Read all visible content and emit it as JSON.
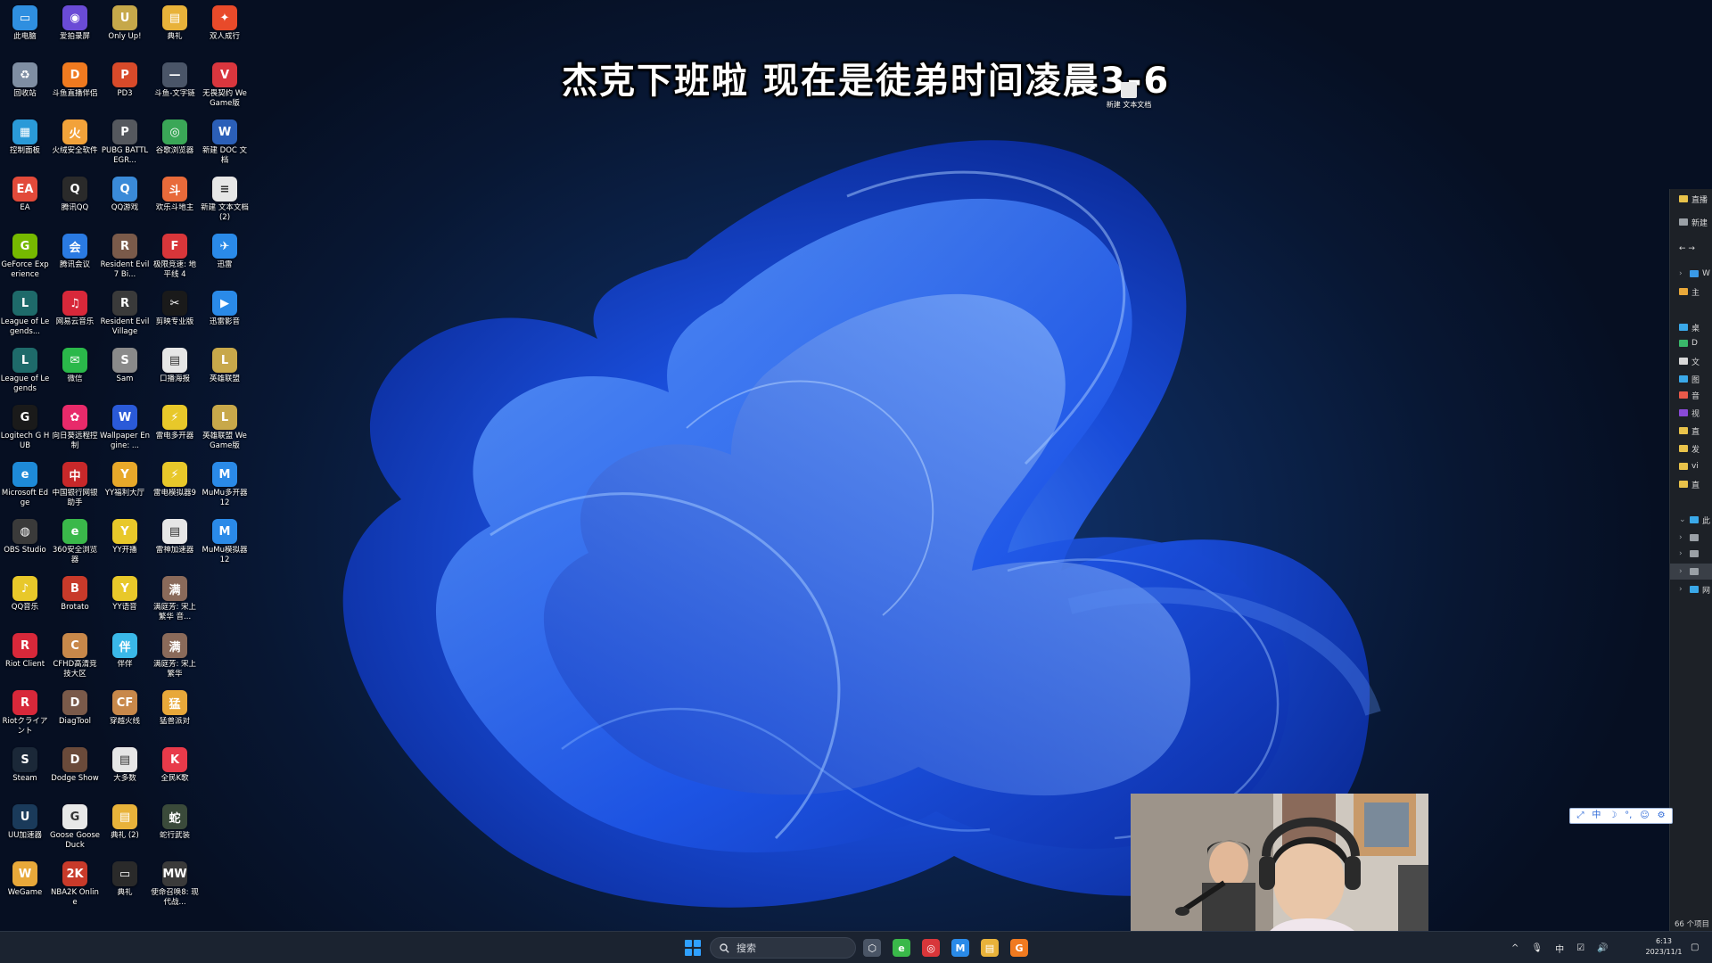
{
  "overlay_caption": "杰克下班啦 现在是徒弟时间凌晨3-6",
  "stray_file_label": "新建 文本文档",
  "desktop_icons": [
    {
      "label": "此电脑",
      "color": "#2f8fe0",
      "glyph": "▭"
    },
    {
      "label": "爱拍录屏",
      "color": "#6a4bd6",
      "glyph": "◉"
    },
    {
      "label": "Only Up!",
      "color": "#c6a84a",
      "glyph": "U"
    },
    {
      "label": "典礼",
      "color": "#e8b23a",
      "glyph": "▤"
    },
    {
      "label": "双人成行",
      "color": "#e84a2a",
      "glyph": "✦"
    },
    {
      "label": "回收站",
      "color": "#7f8ea3",
      "glyph": "♻"
    },
    {
      "label": "斗鱼直播伴侣",
      "color": "#f07a20",
      "glyph": "D"
    },
    {
      "label": "PD3",
      "color": "#d84a2a",
      "glyph": "P"
    },
    {
      "label": "斗鱼-文字链",
      "color": "#4a5568",
      "glyph": "—"
    },
    {
      "label": "无畏契约 WeGame版",
      "color": "#d9363e",
      "glyph": "V"
    },
    {
      "label": "控制面板",
      "color": "#2a9ad8",
      "glyph": "▦"
    },
    {
      "label": "火绒安全软件",
      "color": "#f2a23a",
      "glyph": "火"
    },
    {
      "label": "PUBG BATTLEGR...",
      "color": "#55585e",
      "glyph": "P"
    },
    {
      "label": "谷歌浏览器",
      "color": "#3aa757",
      "glyph": "◎"
    },
    {
      "label": "新建 DOC 文档",
      "color": "#2b5fb8",
      "glyph": "W"
    },
    {
      "label": "EA",
      "color": "#e24a3a",
      "glyph": "EA"
    },
    {
      "label": "腾讯QQ",
      "color": "#2a2a2a",
      "glyph": "Q"
    },
    {
      "label": "QQ游戏",
      "color": "#3a8ad8",
      "glyph": "Q"
    },
    {
      "label": "欢乐斗地主",
      "color": "#e86a3a",
      "glyph": "斗"
    },
    {
      "label": "新建 文本文档 (2)",
      "color": "#e6e6e6",
      "glyph": "≡"
    },
    {
      "label": "GeForce Experience",
      "color": "#76b900",
      "glyph": "G"
    },
    {
      "label": "腾讯会议",
      "color": "#2a7ae2",
      "glyph": "会"
    },
    {
      "label": "Resident Evil 7 Bi...",
      "color": "#7a5a4a",
      "glyph": "R"
    },
    {
      "label": "极限竞速: 地平线 4",
      "color": "#d8363a",
      "glyph": "F"
    },
    {
      "label": "迅雷",
      "color": "#2a8ae8",
      "glyph": "✈"
    },
    {
      "label": "League of Legends...",
      "color": "#1e6a6a",
      "glyph": "L"
    },
    {
      "label": "网易云音乐",
      "color": "#d8283a",
      "glyph": "♫"
    },
    {
      "label": "Resident Evil Village",
      "color": "#3a3a3a",
      "glyph": "R"
    },
    {
      "label": "剪映专业版",
      "color": "#1a1a1a",
      "glyph": "✂"
    },
    {
      "label": "迅雷影音",
      "color": "#2a8ae8",
      "glyph": "▶"
    },
    {
      "label": "League of Legends",
      "color": "#1e6a6a",
      "glyph": "L"
    },
    {
      "label": "微信",
      "color": "#2ab84a",
      "glyph": "✉"
    },
    {
      "label": "Sam",
      "color": "#8a8a8a",
      "glyph": "S"
    },
    {
      "label": "口播海报",
      "color": "#e6e6e6",
      "glyph": "▤"
    },
    {
      "label": "英雄联盟",
      "color": "#c8a84a",
      "glyph": "L"
    },
    {
      "label": "Logitech G HUB",
      "color": "#1a1a1a",
      "glyph": "G"
    },
    {
      "label": "向日葵远程控制",
      "color": "#e82a6a",
      "glyph": "✿"
    },
    {
      "label": "Wallpaper Engine: ...",
      "color": "#2a5ad8",
      "glyph": "W"
    },
    {
      "label": "雷电多开器",
      "color": "#e8c82a",
      "glyph": "⚡"
    },
    {
      "label": "英雄联盟 WeGame版",
      "color": "#c8a84a",
      "glyph": "L"
    },
    {
      "label": "Microsoft Edge",
      "color": "#1e8ad8",
      "glyph": "e"
    },
    {
      "label": "中国银行网银助手",
      "color": "#c8282a",
      "glyph": "中"
    },
    {
      "label": "YY福利大厅",
      "color": "#e8a82a",
      "glyph": "Y"
    },
    {
      "label": "雷电模拟器9",
      "color": "#e8c82a",
      "glyph": "⚡"
    },
    {
      "label": "MuMu多开器12",
      "color": "#2a8ae8",
      "glyph": "M"
    },
    {
      "label": "OBS Studio",
      "color": "#3a3a3a",
      "glyph": "◍"
    },
    {
      "label": "360安全浏览器",
      "color": "#3ab84a",
      "glyph": "e"
    },
    {
      "label": "YY开播",
      "color": "#e8c82a",
      "glyph": "Y"
    },
    {
      "label": "雷神加速器",
      "color": "#e6e6e6",
      "glyph": "▤"
    },
    {
      "label": "MuMu模拟器12",
      "color": "#2a8ae8",
      "glyph": "M"
    },
    {
      "label": "QQ音乐",
      "color": "#e8c82a",
      "glyph": "♪"
    },
    {
      "label": "Brotato",
      "color": "#c83a2a",
      "glyph": "B"
    },
    {
      "label": "YY语音",
      "color": "#e8c82a",
      "glyph": "Y"
    },
    {
      "label": "满庭芳: 宋上繁华 音...",
      "color": "#8a6a5a",
      "glyph": "满"
    },
    {
      "label": "",
      "color": "",
      "glyph": ""
    },
    {
      "label": "Riot Client",
      "color": "#d8283a",
      "glyph": "R"
    },
    {
      "label": "CFHD高清竞技大区",
      "color": "#c8884a",
      "glyph": "C"
    },
    {
      "label": "伴伴",
      "color": "#3ab8e8",
      "glyph": "伴"
    },
    {
      "label": "满庭芳: 宋上繁华",
      "color": "#8a6a5a",
      "glyph": "满"
    },
    {
      "label": "",
      "color": "",
      "glyph": ""
    },
    {
      "label": "Riotクライアント",
      "color": "#d8283a",
      "glyph": "R"
    },
    {
      "label": "DiagTool",
      "color": "#7a5a4a",
      "glyph": "D"
    },
    {
      "label": "穿越火线",
      "color": "#c8884a",
      "glyph": "CF"
    },
    {
      "label": "猛兽派对",
      "color": "#e8a83a",
      "glyph": "猛"
    },
    {
      "label": "",
      "color": "",
      "glyph": ""
    },
    {
      "label": "Steam",
      "color": "#1b2838",
      "glyph": "S"
    },
    {
      "label": "Dodge Show",
      "color": "#6a4a3a",
      "glyph": "D"
    },
    {
      "label": "大多数",
      "color": "#e6e6e6",
      "glyph": "▤"
    },
    {
      "label": "全民K歌",
      "color": "#e83a4a",
      "glyph": "K"
    },
    {
      "label": "",
      "color": "",
      "glyph": ""
    },
    {
      "label": "UU加速器",
      "color": "#1a3a5a",
      "glyph": "U"
    },
    {
      "label": "Goose Goose Duck",
      "color": "#e8e8e8",
      "glyph": "G"
    },
    {
      "label": "典礼 (2)",
      "color": "#e8b23a",
      "glyph": "▤"
    },
    {
      "label": "蛇行武装",
      "color": "#3a4a3a",
      "glyph": "蛇"
    },
    {
      "label": "",
      "color": "",
      "glyph": ""
    },
    {
      "label": "WeGame",
      "color": "#e8a83a",
      "glyph": "W"
    },
    {
      "label": "NBA2K Online",
      "color": "#c83a2a",
      "glyph": "2K"
    },
    {
      "label": "典礼",
      "color": "#2a2a2a",
      "glyph": "▭"
    },
    {
      "label": "使命召唤8: 现代战...",
      "color": "#3a3a3a",
      "glyph": "MW"
    },
    {
      "label": "",
      "color": "",
      "glyph": ""
    }
  ],
  "explorer_panel": {
    "rows": [
      {
        "label": "直播",
        "icon_color": "#e8c24a",
        "chevron": "",
        "selected": false
      },
      {
        "label": "新建",
        "icon_color": "#9aa0a6",
        "chevron": "",
        "selected": false
      },
      {
        "label": "← →",
        "icon_color": "",
        "chevron": "",
        "selected": false
      },
      {
        "label": "W",
        "icon_color": "#3a9ae8",
        "chevron": "›",
        "selected": false
      },
      {
        "label": "主",
        "icon_color": "#e8a83a",
        "chevron": "",
        "selected": false
      },
      {
        "label": "桌",
        "icon_color": "#3aa8e8",
        "chevron": "",
        "selected": false
      },
      {
        "label": "D",
        "icon_color": "#3ab86a",
        "chevron": "",
        "selected": false
      },
      {
        "label": "文",
        "icon_color": "#d8d8d8",
        "chevron": "",
        "selected": false
      },
      {
        "label": "图",
        "icon_color": "#3aa8e8",
        "chevron": "",
        "selected": false
      },
      {
        "label": "音",
        "icon_color": "#e85a4a",
        "chevron": "",
        "selected": false
      },
      {
        "label": "视",
        "icon_color": "#8a4ad8",
        "chevron": "",
        "selected": false
      },
      {
        "label": "直",
        "icon_color": "#e8c24a",
        "chevron": "",
        "selected": false
      },
      {
        "label": "发",
        "icon_color": "#e8c24a",
        "chevron": "",
        "selected": false
      },
      {
        "label": "vi",
        "icon_color": "#e8c24a",
        "chevron": "",
        "selected": false
      },
      {
        "label": "直",
        "icon_color": "#e8c24a",
        "chevron": "",
        "selected": false
      },
      {
        "label": "此",
        "icon_color": "#3aa8e8",
        "chevron": "⌄",
        "selected": false
      },
      {
        "label": "",
        "icon_color": "#9aa0a6",
        "chevron": "›",
        "selected": false
      },
      {
        "label": "",
        "icon_color": "#9aa0a6",
        "chevron": "›",
        "selected": false
      },
      {
        "label": "",
        "icon_color": "#9aa0a6",
        "chevron": "›",
        "selected": true
      },
      {
        "label": "网",
        "icon_color": "#3aa8e8",
        "chevron": "›",
        "selected": false
      }
    ],
    "status_count": "66 个项目"
  },
  "ime_toolbar": [
    "⤢",
    "中",
    "☽",
    "°,",
    "☺",
    "⚙"
  ],
  "taskbar": {
    "search_label": "搜索",
    "apps": [
      {
        "name": "taskview-app",
        "color": "#4a5566",
        "glyph": "⬡"
      },
      {
        "name": "360-browser-app",
        "color": "#3ab84a",
        "glyph": "e"
      },
      {
        "name": "chrome-app",
        "color": "#d8363a",
        "glyph": "◎"
      },
      {
        "name": "mumu-app",
        "color": "#2a8ae8",
        "glyph": "M"
      },
      {
        "name": "file-explorer-app",
        "color": "#e8b23a",
        "glyph": "▤"
      },
      {
        "name": "douyu-app",
        "color": "#f07a20",
        "glyph": "G"
      }
    ],
    "tray": [
      "^",
      "🎙",
      "中",
      "☑",
      "🔊"
    ],
    "time": "6:13",
    "date": "2023/11/1"
  }
}
